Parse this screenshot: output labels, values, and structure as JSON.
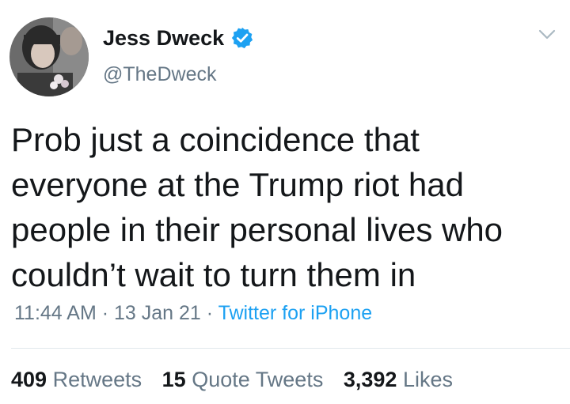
{
  "tweet": {
    "display_name": "Jess Dweck",
    "handle": "@TheDweck",
    "verified": true,
    "text": "Prob just a coincidence that\neveryone at the Trump riot had\npeople in their personal lives who\ncouldn’t wait to turn them in",
    "time": "11:44 AM",
    "date": "13 Jan 21",
    "separator": " · ",
    "source": "Twitter for iPhone"
  },
  "stats": {
    "retweets": {
      "count": "409",
      "label": "Retweets"
    },
    "quote_tweets": {
      "count": "15",
      "label": "Quote Tweets"
    },
    "likes": {
      "count": "3,392",
      "label": "Likes"
    }
  },
  "colors": {
    "text": "#14171a",
    "secondary": "#657786",
    "accent": "#1da1f2",
    "divider": "#e1e8ed"
  },
  "icons": {
    "verified": "verified-badge-icon",
    "menu": "chevron-down-icon"
  }
}
